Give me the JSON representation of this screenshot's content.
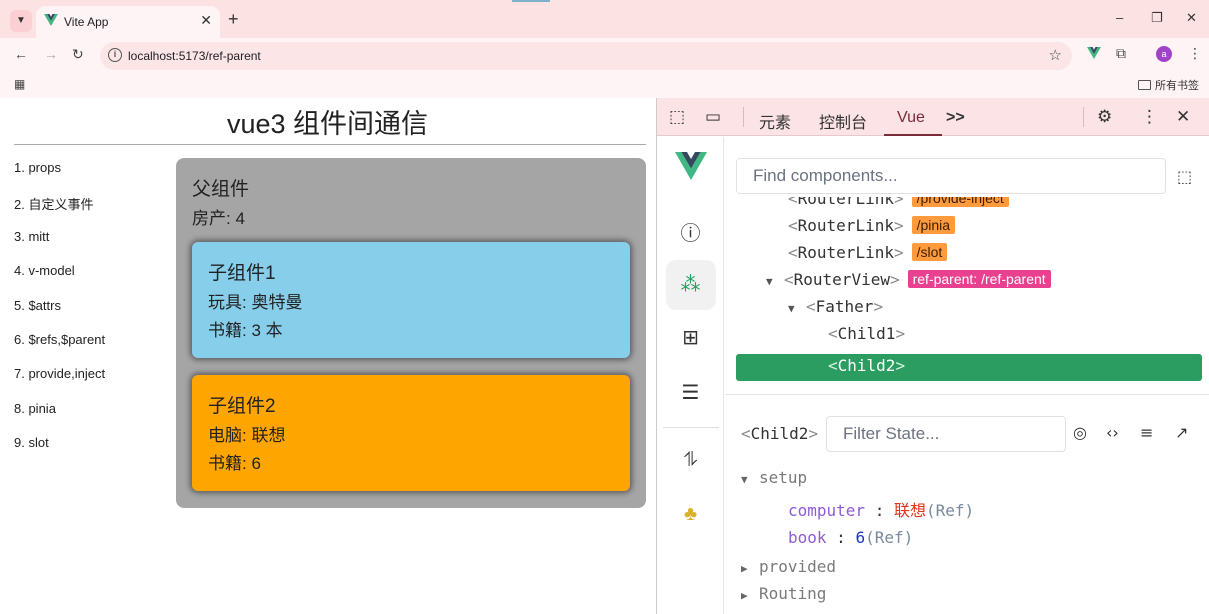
{
  "browser": {
    "tab_title": "Vite App",
    "new_tab_symbol": "+",
    "url": "localhost:5173/ref-parent",
    "bookmarks_folder": "所有书签",
    "window_controls": {
      "minimize": "–",
      "restore": "❐",
      "close": "✕"
    },
    "profile_letter": "a",
    "accent_color": "#fde2e4"
  },
  "page": {
    "title": "vue3 组件间通信",
    "nav_items": [
      "1. props",
      "2. 自定义事件",
      "3. mitt",
      "4. v-model",
      "5. $attrs",
      "6. $refs,$parent",
      "7. provide,inject",
      "8. pinia",
      "9. slot"
    ],
    "father": {
      "title": "父组件",
      "house": "房产: 4",
      "bg_color": "#a5a5a5"
    },
    "child1": {
      "title": "子组件1",
      "toy": "玩具: 奥特曼",
      "book": "书籍: 3 本",
      "bg_color": "#87ceeb"
    },
    "child2": {
      "title": "子组件2",
      "computer": "电脑: 联想",
      "book": "书籍: 6",
      "bg_color": "#ffa500"
    }
  },
  "devtools": {
    "tabs": {
      "elements": "元素",
      "console": "控制台",
      "vue": "Vue",
      "more": ">>"
    },
    "find_placeholder": "Find components...",
    "tree": [
      {
        "indent": 2,
        "tag": "RouterLink",
        "badge": "/provide-inject",
        "badge_type": "orange",
        "arrow": ""
      },
      {
        "indent": 2,
        "tag": "RouterLink",
        "badge": "/pinia",
        "badge_type": "orange",
        "arrow": ""
      },
      {
        "indent": 2,
        "tag": "RouterLink",
        "badge": "/slot",
        "badge_type": "orange",
        "arrow": ""
      },
      {
        "indent": 1,
        "tag": "RouterView",
        "badge": "ref-parent: /ref-parent",
        "badge_type": "pink",
        "arrow": "▼"
      },
      {
        "indent": 2,
        "tag": "Father",
        "badge": "",
        "badge_type": "",
        "arrow": "▼"
      },
      {
        "indent": 3,
        "tag": "Child1",
        "badge": "",
        "badge_type": "",
        "arrow": ""
      },
      {
        "indent": 3,
        "tag": "Child2",
        "badge": "",
        "badge_type": "",
        "arrow": "",
        "selected": true
      }
    ],
    "inspector": {
      "component": "Child2",
      "filter_placeholder": "Filter State...",
      "setup_label": "setup",
      "computer_key": "computer",
      "computer_value": "联想",
      "book_key": "book",
      "book_value": "6",
      "ref_suffix": "(Ref)",
      "provided_label": "provided",
      "routing_label": "Routing"
    },
    "selected_color": "#2b9d60"
  }
}
